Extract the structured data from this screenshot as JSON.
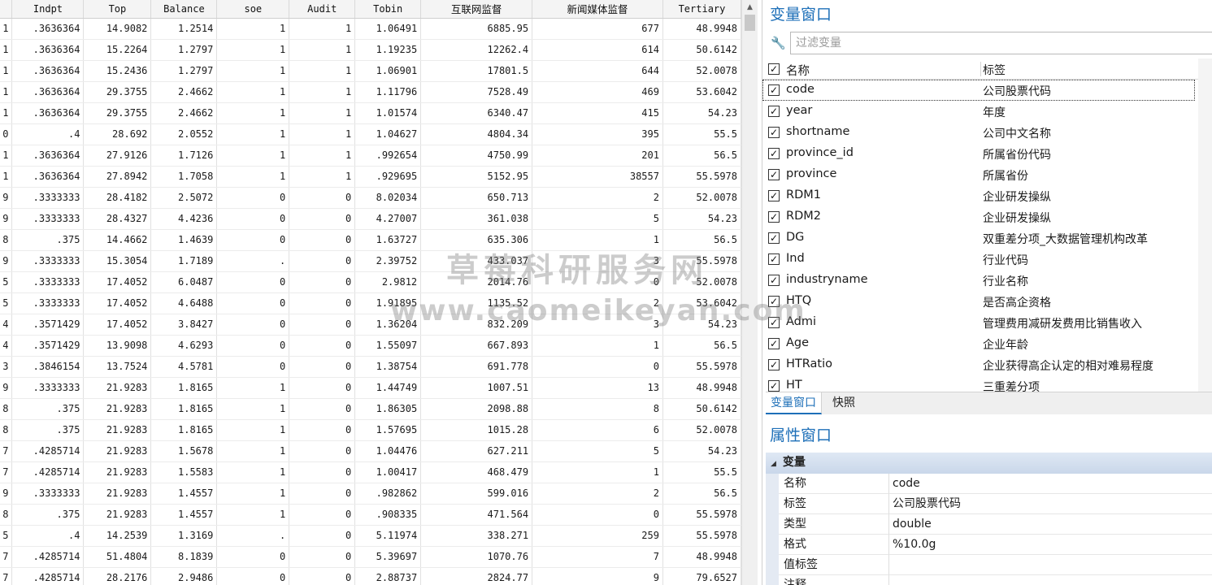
{
  "grid": {
    "columns": [
      "",
      "Indpt",
      "Top",
      "Balance",
      "soe",
      "Audit",
      "Tobin",
      "互联网监督",
      "新闻媒体监督",
      "Tertiary"
    ],
    "rows": [
      [
        "1",
        ".3636364",
        "14.9082",
        "1.2514",
        "1",
        "1",
        "1.06491",
        "6885.95",
        "677",
        "48.9948"
      ],
      [
        "1",
        ".3636364",
        "15.2264",
        "1.2797",
        "1",
        "1",
        "1.19235",
        "12262.4",
        "614",
        "50.6142"
      ],
      [
        "1",
        ".3636364",
        "15.2436",
        "1.2797",
        "1",
        "1",
        "1.06901",
        "17801.5",
        "644",
        "52.0078"
      ],
      [
        "1",
        ".3636364",
        "29.3755",
        "2.4662",
        "1",
        "1",
        "1.11796",
        "7528.49",
        "469",
        "53.6042"
      ],
      [
        "1",
        ".3636364",
        "29.3755",
        "2.4662",
        "1",
        "1",
        "1.01574",
        "6340.47",
        "415",
        "54.23"
      ],
      [
        "0",
        ".4",
        "28.692",
        "2.0552",
        "1",
        "1",
        "1.04627",
        "4804.34",
        "395",
        "55.5"
      ],
      [
        "1",
        ".3636364",
        "27.9126",
        "1.7126",
        "1",
        "1",
        ".992654",
        "4750.99",
        "201",
        "56.5"
      ],
      [
        "1",
        ".3636364",
        "27.8942",
        "1.7058",
        "1",
        "1",
        ".929695",
        "5152.95",
        "38557",
        "55.5978"
      ],
      [
        "9",
        ".3333333",
        "28.4182",
        "2.5072",
        "0",
        "0",
        "8.02034",
        "650.713",
        "2",
        "52.0078"
      ],
      [
        "9",
        ".3333333",
        "28.4327",
        "4.4236",
        "0",
        "0",
        "4.27007",
        "361.038",
        "5",
        "54.23"
      ],
      [
        "8",
        ".375",
        "14.4662",
        "1.4639",
        "0",
        "0",
        "1.63727",
        "635.306",
        "1",
        "56.5"
      ],
      [
        "9",
        ".3333333",
        "15.3054",
        "1.7189",
        ".",
        "0",
        "2.39752",
        "433.037",
        "3",
        "55.5978"
      ],
      [
        "5",
        ".3333333",
        "17.4052",
        "6.0487",
        "0",
        "0",
        "2.9812",
        "2014.76",
        "0",
        "52.0078"
      ],
      [
        "5",
        ".3333333",
        "17.4052",
        "4.6488",
        "0",
        "0",
        "1.91895",
        "1135.52",
        "2",
        "53.6042"
      ],
      [
        "4",
        ".3571429",
        "17.4052",
        "3.8427",
        "0",
        "0",
        "1.36204",
        "832.209",
        "3",
        "54.23"
      ],
      [
        "4",
        ".3571429",
        "13.9098",
        "4.6293",
        "0",
        "0",
        "1.55097",
        "667.893",
        "1",
        "56.5"
      ],
      [
        "3",
        ".3846154",
        "13.7524",
        "4.5781",
        "0",
        "0",
        "1.38754",
        "691.778",
        "0",
        "55.5978"
      ],
      [
        "9",
        ".3333333",
        "21.9283",
        "1.8165",
        "1",
        "0",
        "1.44749",
        "1007.51",
        "13",
        "48.9948"
      ],
      [
        "8",
        ".375",
        "21.9283",
        "1.8165",
        "1",
        "0",
        "1.86305",
        "2098.88",
        "8",
        "50.6142"
      ],
      [
        "8",
        ".375",
        "21.9283",
        "1.8165",
        "1",
        "0",
        "1.57695",
        "1015.28",
        "6",
        "52.0078"
      ],
      [
        "7",
        ".4285714",
        "21.9283",
        "1.5678",
        "1",
        "0",
        "1.04476",
        "627.211",
        "5",
        "54.23"
      ],
      [
        "7",
        ".4285714",
        "21.9283",
        "1.5583",
        "1",
        "0",
        "1.00417",
        "468.479",
        "1",
        "55.5"
      ],
      [
        "9",
        ".3333333",
        "21.9283",
        "1.4557",
        "1",
        "0",
        ".982862",
        "599.016",
        "2",
        "56.5"
      ],
      [
        "8",
        ".375",
        "21.9283",
        "1.4557",
        "1",
        "0",
        ".908335",
        "471.564",
        "0",
        "55.5978"
      ],
      [
        "5",
        ".4",
        "14.2539",
        "1.3169",
        ".",
        "0",
        "5.11974",
        "338.271",
        "259",
        "55.5978"
      ],
      [
        "7",
        ".4285714",
        "51.4804",
        "8.1839",
        "0",
        "0",
        "5.39697",
        "1070.76",
        "7",
        "48.9948"
      ],
      [
        "7",
        ".4285714",
        "28.2176",
        "2.9486",
        "0",
        "0",
        "2.88737",
        "2824.77",
        "9",
        "79.6527"
      ]
    ]
  },
  "variables_window": {
    "title": "变量窗口",
    "filter_placeholder": "过滤变量",
    "header": {
      "name": "名称",
      "label": "标签"
    },
    "items": [
      {
        "name": "code",
        "label": "公司股票代码"
      },
      {
        "name": "year",
        "label": "年度"
      },
      {
        "name": "shortname",
        "label": "公司中文名称"
      },
      {
        "name": "province_id",
        "label": "所属省份代码"
      },
      {
        "name": "province",
        "label": "所属省份"
      },
      {
        "name": "RDM1",
        "label": "企业研发操纵"
      },
      {
        "name": "RDM2",
        "label": "企业研发操纵"
      },
      {
        "name": "DG",
        "label": "双重差分项_大数据管理机构改革"
      },
      {
        "name": "Ind",
        "label": "行业代码"
      },
      {
        "name": "industryname",
        "label": "行业名称"
      },
      {
        "name": "HTQ",
        "label": "是否高企资格"
      },
      {
        "name": "Admi",
        "label": "管理费用减研发费用比销售收入"
      },
      {
        "name": "Age",
        "label": "企业年龄"
      },
      {
        "name": "HTRatio",
        "label": "企业获得高企认定的相对难易程度"
      },
      {
        "name": "HT",
        "label": "三重差分项"
      }
    ],
    "check_mark": "✓"
  },
  "tabs": {
    "variables": "变量窗口",
    "snapshots": "快照"
  },
  "properties_window": {
    "title": "属性窗口",
    "group": "变量",
    "group_toggle": "◢",
    "rows": [
      {
        "key": "名称",
        "value": "code"
      },
      {
        "key": "标签",
        "value": "公司股票代码"
      },
      {
        "key": "类型",
        "value": "double"
      },
      {
        "key": "格式",
        "value": "%10.0g"
      },
      {
        "key": "值标签",
        "value": ""
      },
      {
        "key": "注释",
        "value": ""
      }
    ]
  },
  "watermark": {
    "line1": "草莓科研服务网",
    "line2": "www.caomeikeyan.com"
  },
  "icons": {
    "filter": "wrench-icon",
    "scroll_up": "scroll-up-arrow-icon"
  },
  "colors": {
    "accent": "#1d6fb8"
  }
}
